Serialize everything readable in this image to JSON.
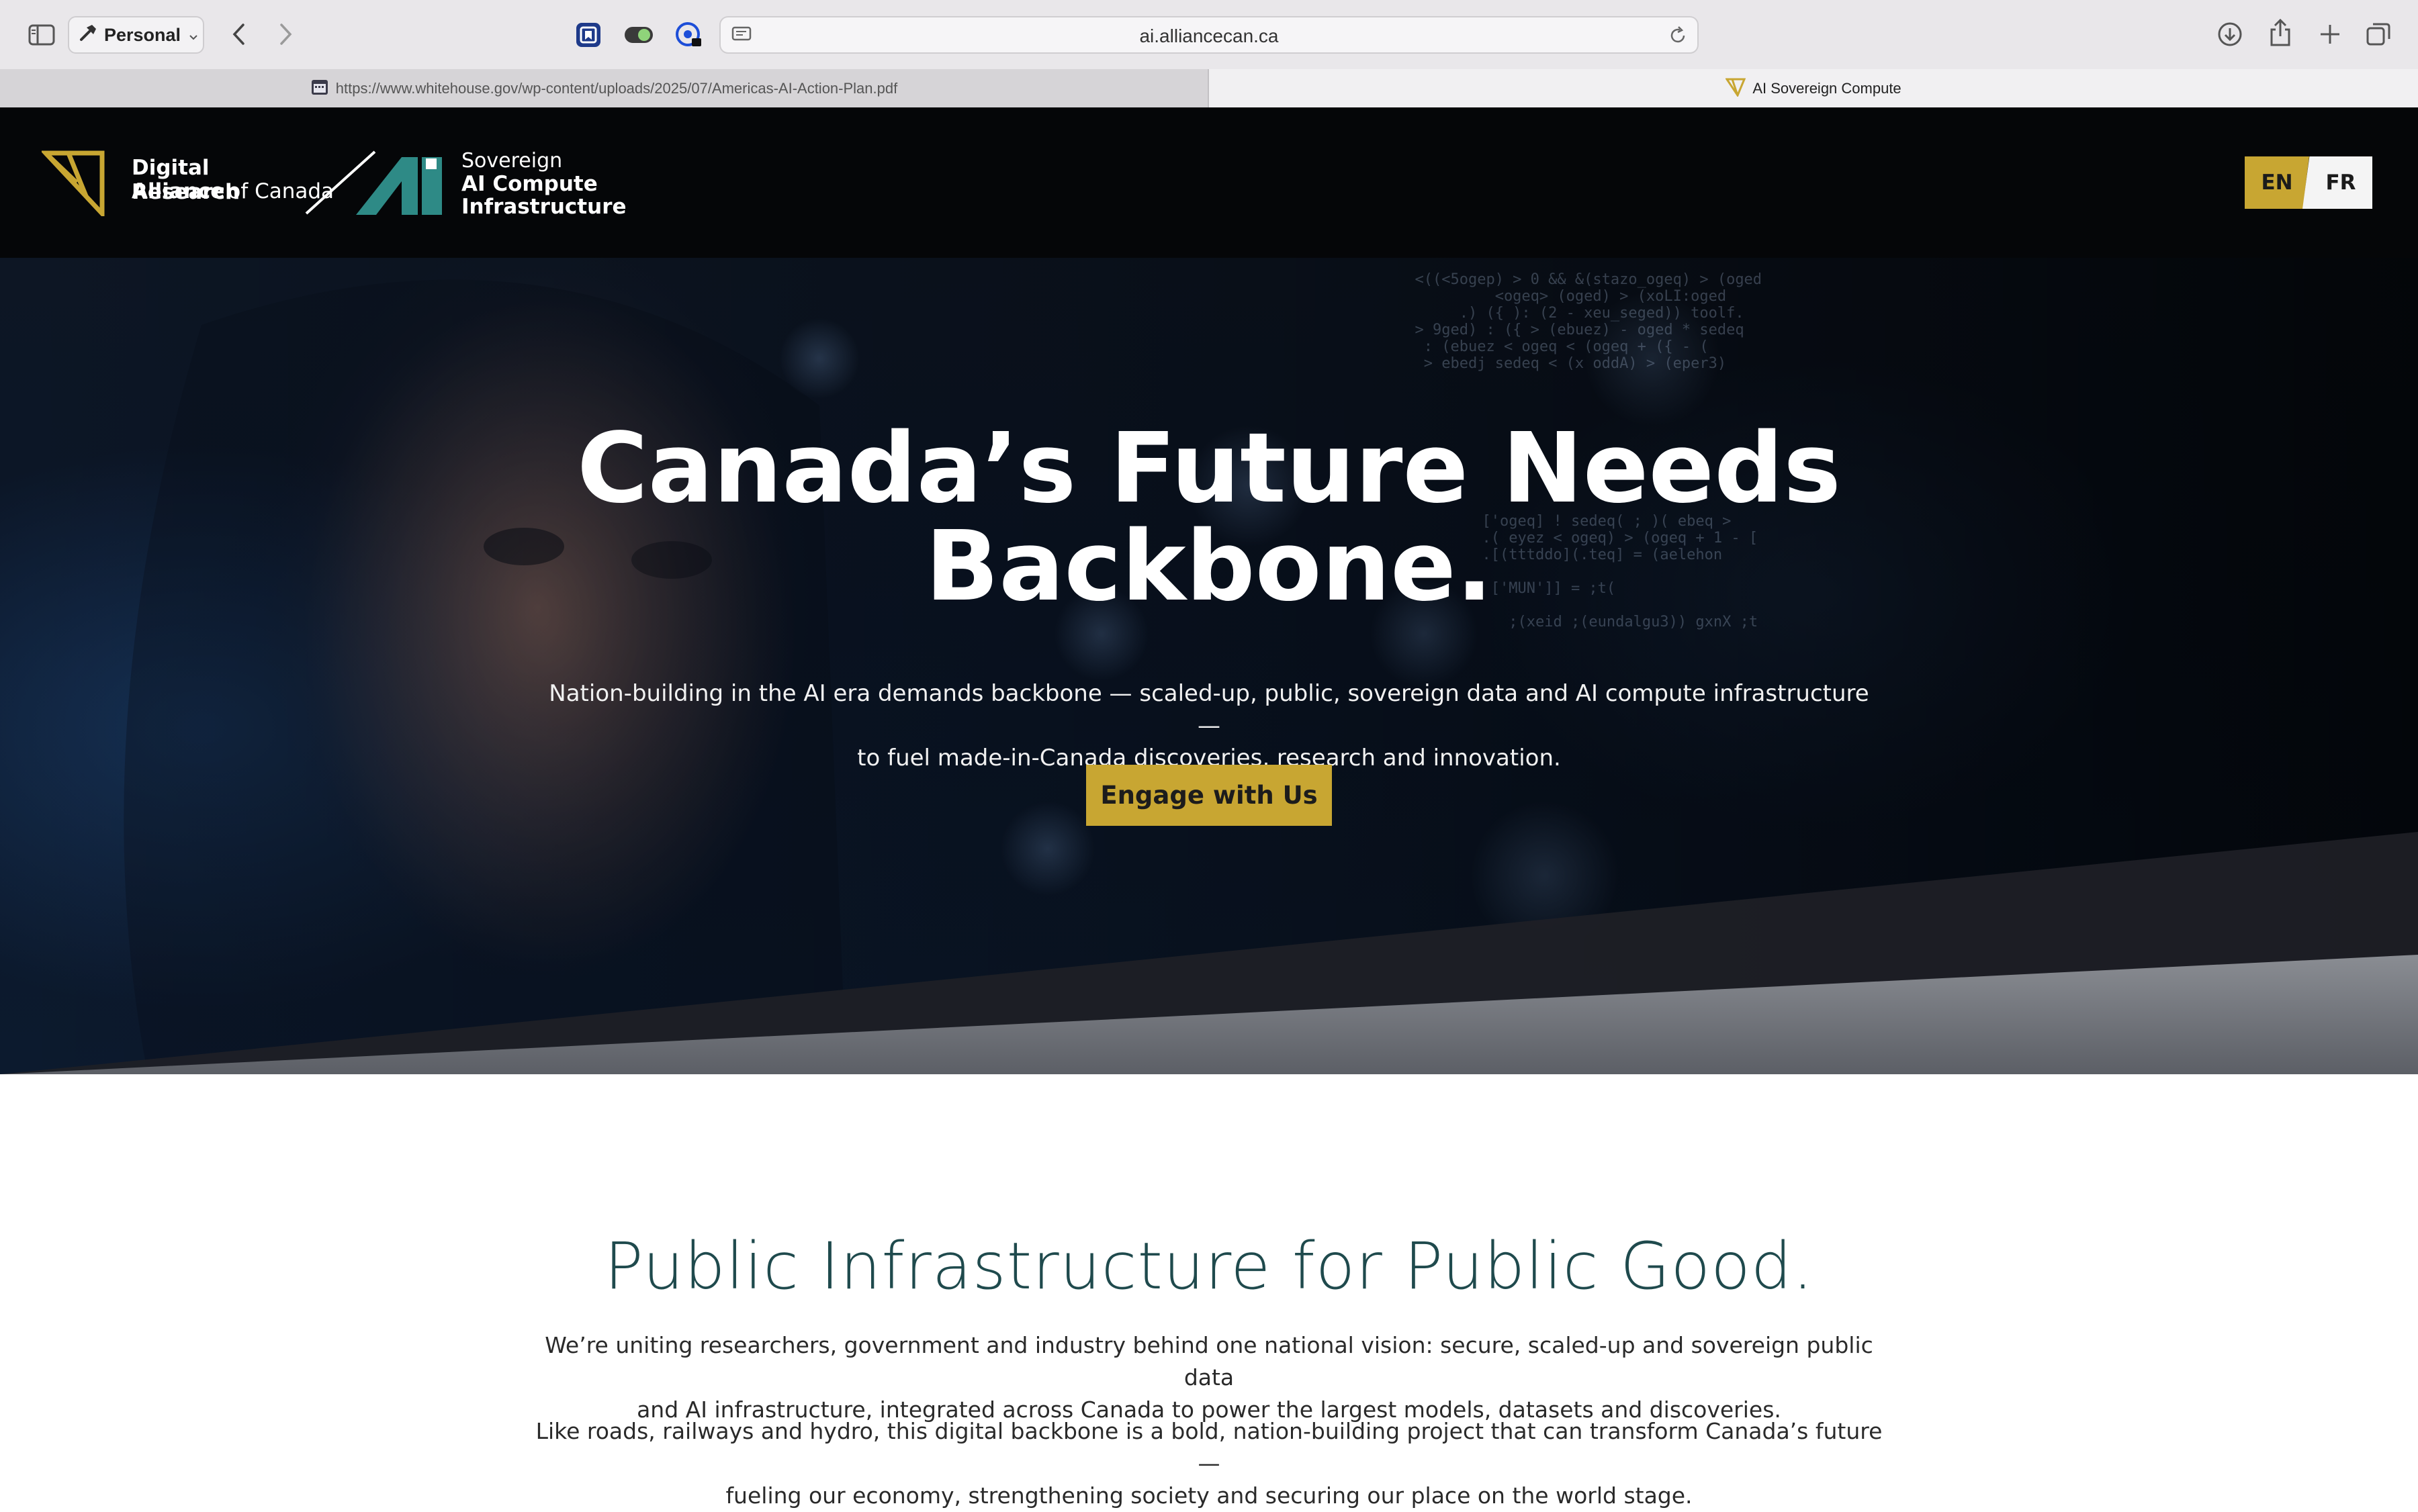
{
  "browser": {
    "profile_label": "Personal",
    "address": "ai.alliancecan.ca",
    "tabs": [
      {
        "label": "https://www.whitehouse.gov/wp-content/uploads/2025/07/Americas-AI-Action-Plan.pdf"
      },
      {
        "label": "AI Sovereign Compute"
      }
    ]
  },
  "header": {
    "org_line1": "Digital Research",
    "org_line2_bold": "Alliance",
    "org_line2_rest": "of Canada",
    "program_line1": "Sovereign",
    "program_line2": "AI Compute",
    "program_line3": "Infrastructure",
    "lang_en": "EN",
    "lang_fr": "FR"
  },
  "hero": {
    "title_line1": "Canada’s Future Needs",
    "title_line2": "Backbone.",
    "subtitle_line1": "Nation-building in the AI era demands backbone — scaled-up, public, sovereign data and AI compute infrastructure —",
    "subtitle_line2": "to fuel made-in-Canada discoveries, research and innovation.",
    "cta_label": "Engage with Us"
  },
  "content": {
    "title": "Public Infrastructure for Public Good.",
    "para1_line1": "We’re uniting researchers, government and industry behind one national vision: secure, scaled-up and sovereign public data",
    "para1_line2": "and AI infrastructure, integrated across Canada to power the largest models, datasets and discoveries.",
    "para2_line1": "Like roads, railways and hydro, this digital backbone is a bold, nation-building project that can transform Canada’s future —",
    "para2_line2": "fueling our economy, strengthening society and securing our place on the world stage."
  },
  "colors": {
    "accent_gold": "#c8a632",
    "teal": "#1f4a4d",
    "header_bg": "#050608"
  }
}
